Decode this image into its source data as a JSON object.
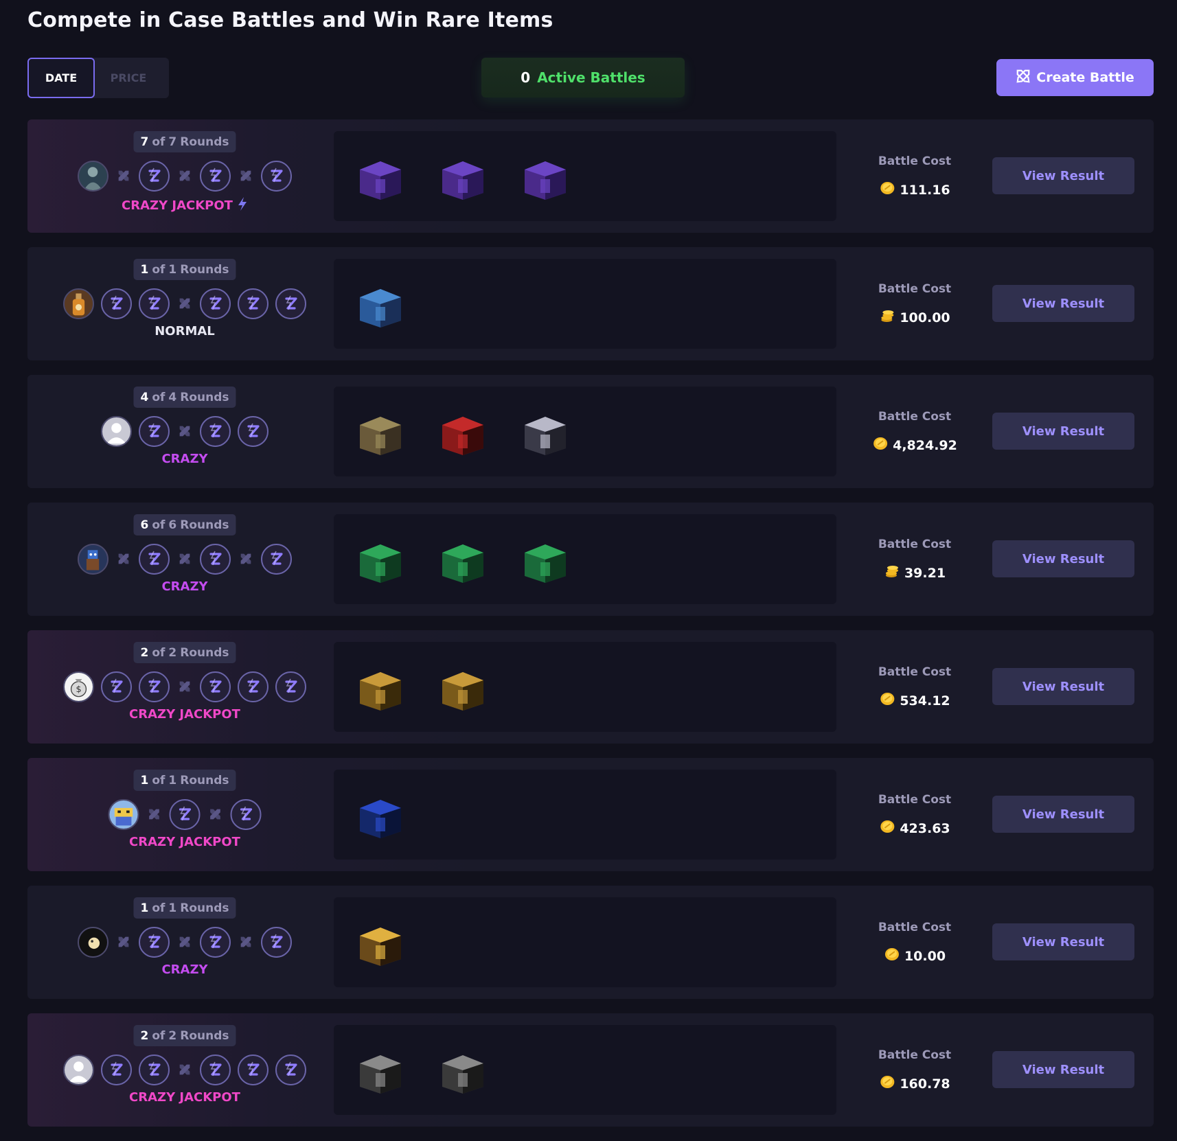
{
  "page": {
    "title": "Compete in Case Battles and Win Rare Items"
  },
  "sort": {
    "date_label": "DATE",
    "price_label": "PRICE",
    "active": "date"
  },
  "active_battles": {
    "count": "0",
    "label": "Active Battles"
  },
  "create_battle": {
    "label": "Create Battle"
  },
  "colors": {
    "accent": "#8b76f6",
    "crazy_jackpot": "#f048c8",
    "crazy": "#c44cf0",
    "active_green": "#4fe06a"
  },
  "battles": [
    {
      "rounds_current": "7",
      "rounds_of": "of",
      "rounds_total": "7",
      "rounds_word": "Rounds",
      "players": [
        "avatar",
        "vs",
        "slot",
        "vs",
        "slot",
        "vs",
        "slot"
      ],
      "avatar_icon": "soldier-avatar-icon",
      "mode": "CRAZY JACKPOT",
      "mode_type": "crazy-jackpot",
      "mode_bolt": true,
      "cases": [
        "purple-case",
        "purple-case",
        "purple-case"
      ],
      "cost_label": "Battle Cost",
      "cost": "111.16",
      "coin_icon": "coin-icon",
      "view_label": "View Result"
    },
    {
      "rounds_current": "1",
      "rounds_of": "of",
      "rounds_total": "1",
      "rounds_word": "Rounds",
      "players": [
        "avatar",
        "slot",
        "slot",
        "vs",
        "slot",
        "slot",
        "slot"
      ],
      "avatar_icon": "bottle-avatar-icon",
      "mode": "NORMAL",
      "mode_type": "normal",
      "mode_bolt": false,
      "cases": [
        "blue-case"
      ],
      "cost_label": "Battle Cost",
      "cost": "100.00",
      "coin_icon": "coin-stack-icon",
      "view_label": "View Result"
    },
    {
      "rounds_current": "4",
      "rounds_of": "of",
      "rounds_total": "4",
      "rounds_word": "Rounds",
      "players": [
        "avatar",
        "slot",
        "vs",
        "slot",
        "slot"
      ],
      "avatar_icon": "default-user-avatar-icon",
      "mode": "CRAZY",
      "mode_type": "crazy",
      "mode_bolt": false,
      "cases": [
        "skull-case",
        "reaper-case",
        "cloud-case"
      ],
      "cost_label": "Battle Cost",
      "cost": "4,824.92",
      "coin_icon": "coin-icon",
      "view_label": "View Result"
    },
    {
      "rounds_current": "6",
      "rounds_of": "of",
      "rounds_total": "6",
      "rounds_word": "Rounds",
      "players": [
        "avatar",
        "vs",
        "slot",
        "vs",
        "slot",
        "vs",
        "slot"
      ],
      "avatar_icon": "character-avatar-icon",
      "mode": "CRAZY",
      "mode_type": "crazy",
      "mode_bolt": false,
      "cases": [
        "green-case",
        "green-case",
        "green-case"
      ],
      "cost_label": "Battle Cost",
      "cost": "39.21",
      "coin_icon": "coin-stack-icon",
      "view_label": "View Result"
    },
    {
      "rounds_current": "2",
      "rounds_of": "of",
      "rounds_total": "2",
      "rounds_word": "Rounds",
      "players": [
        "avatar",
        "slot",
        "slot",
        "vs",
        "slot",
        "slot",
        "slot"
      ],
      "avatar_icon": "money-bag-avatar-icon",
      "mode": "CRAZY JACKPOT",
      "mode_type": "crazy-jackpot",
      "mode_bolt": false,
      "cases": [
        "gold-case",
        "gold-case"
      ],
      "cost_label": "Battle Cost",
      "cost": "534.12",
      "coin_icon": "coin-icon",
      "view_label": "View Result"
    },
    {
      "rounds_current": "1",
      "rounds_of": "of",
      "rounds_total": "1",
      "rounds_word": "Rounds",
      "players": [
        "avatar",
        "vs",
        "slot",
        "vs",
        "slot"
      ],
      "avatar_icon": "blocky-avatar-icon",
      "mode": "CRAZY JACKPOT",
      "mode_type": "crazy-jackpot",
      "mode_bolt": false,
      "cases": [
        "electric-blue-case"
      ],
      "cost_label": "Battle Cost",
      "cost": "423.63",
      "coin_icon": "coin-icon",
      "view_label": "View Result"
    },
    {
      "rounds_current": "1",
      "rounds_of": "of",
      "rounds_total": "1",
      "rounds_word": "Rounds",
      "players": [
        "avatar",
        "vs",
        "slot",
        "vs",
        "slot",
        "vs",
        "slot"
      ],
      "avatar_icon": "dark-avatar-icon",
      "mode": "CRAZY",
      "mode_type": "crazy",
      "mode_bolt": false,
      "cases": [
        "golden-wing-case"
      ],
      "cost_label": "Battle Cost",
      "cost": "10.00",
      "coin_icon": "coin-icon",
      "view_label": "View Result"
    },
    {
      "rounds_current": "2",
      "rounds_of": "of",
      "rounds_total": "2",
      "rounds_word": "Rounds",
      "players": [
        "avatar",
        "slot",
        "slot",
        "vs",
        "slot",
        "slot",
        "slot"
      ],
      "avatar_icon": "default-user-avatar-icon",
      "mode": "CRAZY JACKPOT",
      "mode_type": "crazy-jackpot",
      "mode_bolt": false,
      "cases": [
        "pirate-case",
        "pirate-case"
      ],
      "cost_label": "Battle Cost",
      "cost": "160.78",
      "coin_icon": "coin-icon",
      "view_label": "View Result"
    }
  ]
}
